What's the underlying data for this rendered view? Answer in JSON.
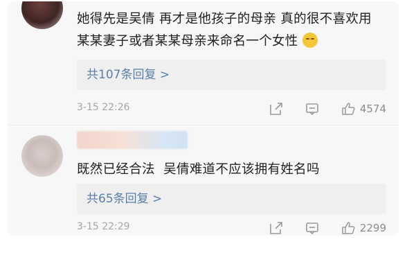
{
  "comments": [
    {
      "text": "她得先是吴倩 再才是他孩子的母亲 真的很不喜欢用某某妻子或者某某母亲来命名一个女性",
      "emoji": "smile-emoji-icon",
      "replies_label": "共107条回复 >",
      "time": "3-15 22:26",
      "likes": "4574"
    },
    {
      "text": "既然已经合法  吴倩难道不应该拥有姓名吗",
      "replies_label": "共65条回复 >",
      "time": "3-15 22:29",
      "likes": "2299"
    }
  ],
  "icons": {
    "share": "share-icon",
    "comment": "comment-icon",
    "like": "thumbs-up-icon"
  },
  "colors": {
    "link": "#5b7fa8",
    "muted": "#a6a6a6",
    "text": "#1f1f1f",
    "card": "#f7f7f7"
  }
}
